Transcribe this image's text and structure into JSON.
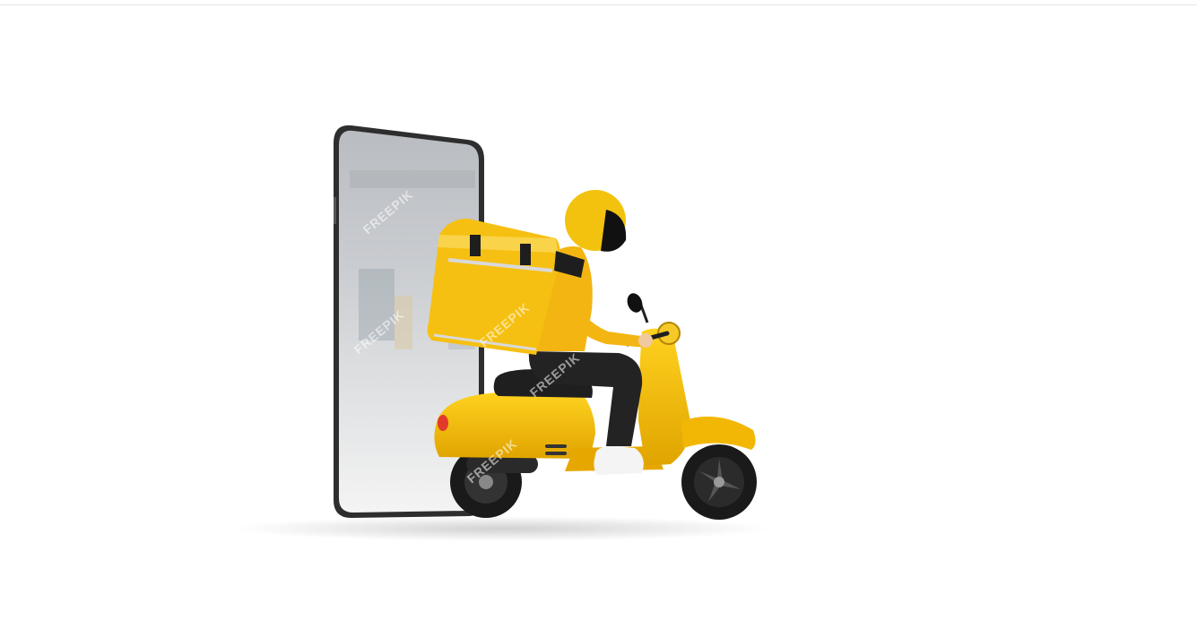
{
  "image": {
    "subject": "delivery-rider-on-scooter-emerging-from-smartphone",
    "watermark_text": "FREEPIK",
    "colors": {
      "background": "#ffffff",
      "scooter": "#f2b705",
      "bag": "#f6c012",
      "helmet": "#f3c20f",
      "phone_frame": "#3a3a3a",
      "tire": "#1a1a1a",
      "pants": "#232323"
    }
  }
}
